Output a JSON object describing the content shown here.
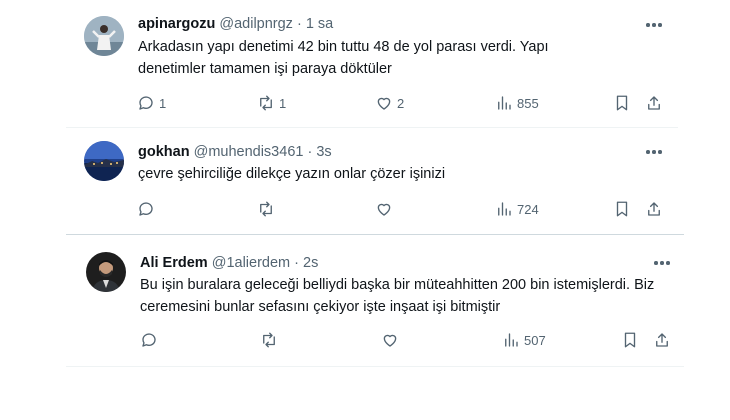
{
  "tweets": [
    {
      "name": "apinargozu",
      "handle": "@adilpnrgz",
      "time": "1 sa",
      "text": "Arkadasın yapı denetimi 42 bin tuttu 48 de yol parası verdi. Yapı denetimler tamamen işi paraya döktüler",
      "replies": "1",
      "retweets": "1",
      "likes": "2",
      "views": "855"
    },
    {
      "name": "gokhan",
      "handle": "@muhendis3461",
      "time": "3s",
      "text": "çevre şehirciliğe dilekçe yazın onlar çözer işinizi",
      "replies": "",
      "retweets": "",
      "likes": "",
      "views": "724"
    },
    {
      "name": "Ali Erdem",
      "handle": "@1alierdem",
      "time": "2s",
      "text": "Bu işin buralara geleceği belliydi başka bir müteahhitten 200 bin istemişlerdi. Biz ceremesini bunlar sefasını çekiyor işte inşaat işi bitmiştir",
      "replies": "",
      "retweets": "",
      "likes": "",
      "views": "507"
    }
  ],
  "separator": "·",
  "icons": {
    "reply": "reply-icon",
    "retweet": "retweet-icon",
    "like": "like-icon",
    "views": "views-icon",
    "bookmark": "bookmark-icon",
    "share": "share-icon",
    "more": "more-icon"
  },
  "colors": {
    "text": "#0f1419",
    "secondary": "#536471",
    "border": "#eff3f4"
  }
}
